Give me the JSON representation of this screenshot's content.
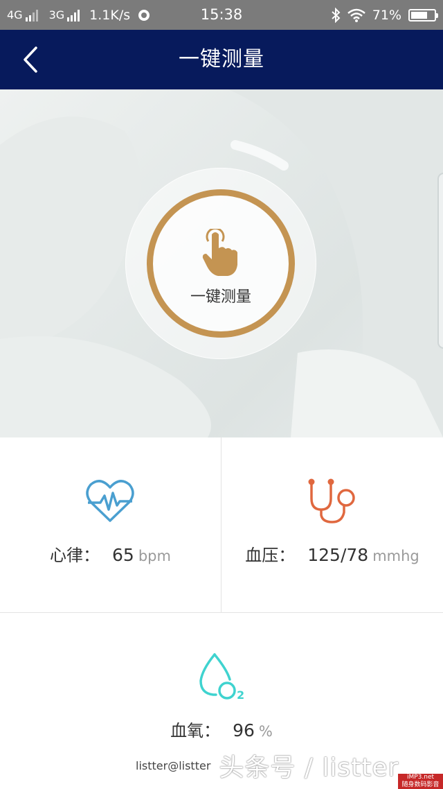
{
  "status_bar": {
    "network1": "4G",
    "network2": "3G",
    "speed": "1.1K/s",
    "time": "15:38",
    "battery_percent": "71%",
    "battery_level": 0.71
  },
  "nav": {
    "title": "一键测量"
  },
  "measure_button": {
    "label": "一键测量"
  },
  "metrics": {
    "heart_rate": {
      "label": "心律：",
      "value": "65",
      "unit": "bpm",
      "color": "#4a9fd0"
    },
    "blood_pressure": {
      "label": "血压：",
      "value": "125/78",
      "unit": "mmhg",
      "color": "#e0683f"
    },
    "blood_oxygen": {
      "label": "血氧：",
      "value": "96",
      "unit": "%",
      "color": "#3fd3cf"
    }
  },
  "watermark": {
    "small": "listter@listter",
    "big": "头条号 / listter",
    "badge_line1": "iMP3.net",
    "badge_line2": "随身数码影音"
  },
  "colors": {
    "nav_bg": "#071a5c",
    "accent_ring": "#c49452"
  }
}
